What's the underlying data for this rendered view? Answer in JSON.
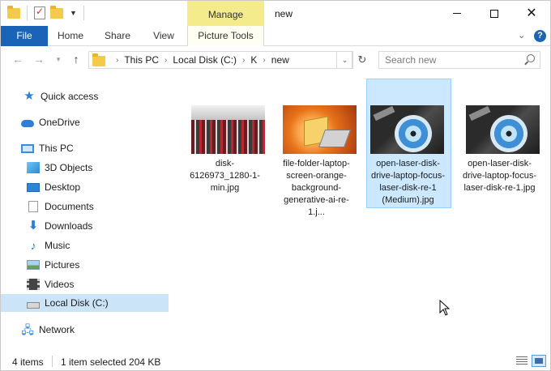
{
  "title_bar": {
    "manage_label": "Manage",
    "window_title": "new",
    "minimize": "minimize",
    "maximize": "maximize",
    "close": "close"
  },
  "ribbon": {
    "tabs": [
      "File",
      "Home",
      "Share",
      "View",
      "Picture Tools"
    ],
    "help_label": "?"
  },
  "nav": {
    "breadcrumbs": [
      "This PC",
      "Local Disk (C:)",
      "K",
      "new"
    ],
    "search_placeholder": "Search new"
  },
  "sidebar": {
    "items": [
      {
        "label": "Quick access",
        "icon": "star-icon"
      },
      {
        "label": "OneDrive",
        "icon": "cloud-icon"
      },
      {
        "label": "This PC",
        "icon": "computer-icon"
      },
      {
        "label": "3D Objects",
        "icon": "cube-icon"
      },
      {
        "label": "Desktop",
        "icon": "desktop-icon"
      },
      {
        "label": "Documents",
        "icon": "document-icon"
      },
      {
        "label": "Downloads",
        "icon": "download-icon"
      },
      {
        "label": "Music",
        "icon": "music-icon"
      },
      {
        "label": "Pictures",
        "icon": "pictures-icon"
      },
      {
        "label": "Videos",
        "icon": "videos-icon"
      },
      {
        "label": "Local Disk (C:)",
        "icon": "disk-icon",
        "selected": true
      },
      {
        "label": "Network",
        "icon": "network-icon"
      }
    ]
  },
  "files": [
    {
      "name": "disk-6126973_1280-1-min.jpg",
      "selected": false
    },
    {
      "name": "file-folder-laptop-screen-orange-background-generative-ai-re-1.j...",
      "selected": false
    },
    {
      "name": "open-laser-disk-drive-laptop-focus-laser-disk-re-1 (Medium).jpg",
      "selected": true
    },
    {
      "name": "open-laser-disk-drive-laptop-focus-laser-disk-re-1.jpg",
      "selected": false
    }
  ],
  "status": {
    "item_count": "4 items",
    "selection": "1 item selected  204 KB"
  },
  "colors": {
    "accent": "#1a63b6",
    "manage_tab": "#f4ec8c",
    "selection": "#cce8ff"
  }
}
